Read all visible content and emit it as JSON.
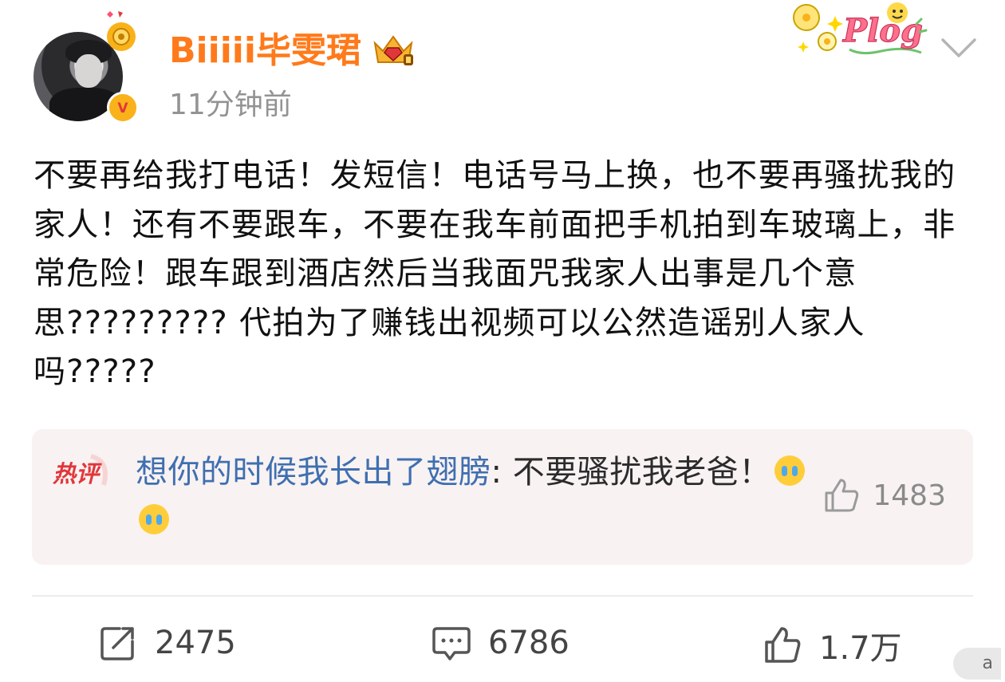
{
  "post": {
    "username": "Biiiii毕雯珺",
    "timestamp": "11分钟前",
    "content": "不要再给我打电话！发短信！电话号马上换，也不要再骚扰我的家人！还有不要跟车，不要在我车前面把手机拍到车玻璃上，非常危险！跟车跟到酒店然后当我面咒我家人出事是几个意思????????? 代拍为了赚钱出视频可以公然造谣别人家人吗?????"
  },
  "badges": {
    "verified_mark": "V",
    "plog_text": "Plog"
  },
  "hot_comment": {
    "label": "热评",
    "commenter": "想你的时候我长出了翅膀",
    "separator": ": ",
    "text": "不要骚扰我老爸！",
    "likes": "1483"
  },
  "actions": {
    "repost_count": "2475",
    "comment_count": "6786",
    "like_count": "1.7万"
  },
  "colors": {
    "username": "#ff7a1a",
    "commenter_link": "#3f6fb0",
    "hot_label": "#e0373a",
    "vip_badge": "#f9b21a",
    "comment_bg": "#f8f2f2"
  }
}
